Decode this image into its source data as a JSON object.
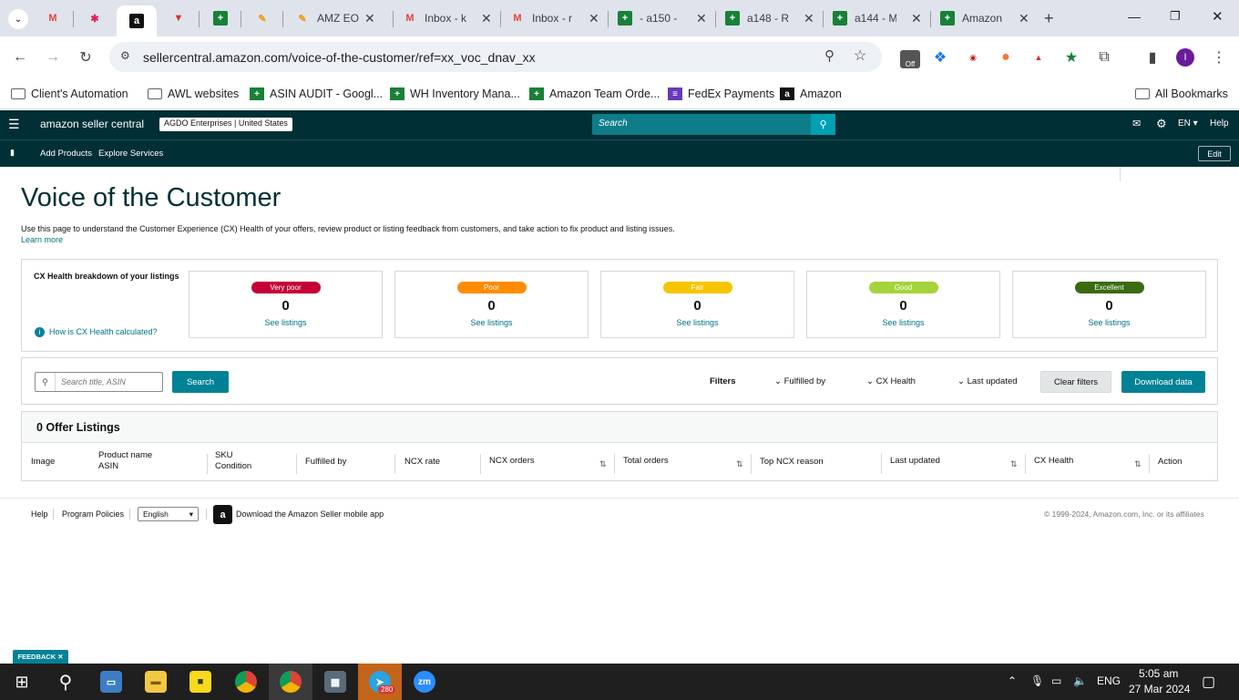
{
  "browser": {
    "tabs": [
      {
        "title": "",
        "icon": "gmail-icon"
      },
      {
        "title": "",
        "icon": "slack-icon"
      },
      {
        "title": "",
        "icon": "amazon-icon",
        "active": true
      },
      {
        "title": "",
        "icon": "red-v-icon"
      },
      {
        "title": "",
        "icon": "sheets-icon"
      },
      {
        "title": "",
        "icon": "pen-icon"
      },
      {
        "title": "AMZ EOD",
        "icon": "pen-icon"
      },
      {
        "title": "Inbox - k",
        "icon": "gmail-icon"
      },
      {
        "title": "Inbox - r",
        "icon": "gmail-icon"
      },
      {
        "title": "- a150 -",
        "icon": "sheets-icon"
      },
      {
        "title": "a148 - R",
        "icon": "sheets-icon"
      },
      {
        "title": "a144 - M",
        "icon": "sheets-icon"
      },
      {
        "title": "Amazon",
        "icon": "sheets-icon"
      }
    ],
    "url": "sellercentral.amazon.com/voice-of-the-customer/ref=xx_voc_dnav_xx",
    "profile_initial": "I",
    "ext_badge_off": "Off",
    "bookmarks": [
      {
        "label": "Client's Automation",
        "icon": "folder-icon"
      },
      {
        "label": "AWL websites",
        "icon": "folder-icon"
      },
      {
        "label": "ASIN AUDIT - Googl...",
        "icon": "sheets-icon"
      },
      {
        "label": "WH Inventory Mana...",
        "icon": "sheets-icon"
      },
      {
        "label": "Amazon Team Orde...",
        "icon": "sheets-icon"
      },
      {
        "label": "FedEx Payments",
        "icon": "forms-icon"
      },
      {
        "label": "Amazon",
        "icon": "amazon-icon"
      }
    ],
    "all_bookmarks": "All Bookmarks"
  },
  "header": {
    "logo": "amazon seller central",
    "account_name": "AGDO Enterprises",
    "account_region": "United States",
    "search_placeholder": "Search",
    "language": "EN",
    "help": "Help",
    "nav": [
      "Add Products",
      "Explore Services"
    ],
    "edit": "Edit"
  },
  "page": {
    "title": "Voice of the Customer",
    "description": "Use this page to understand the Customer Experience (CX) Health of your offers, review product or listing feedback from customers, and take action to fix product and listing issues.",
    "learn_more": "Learn more",
    "breakdown_title": "CX Health breakdown of your listings",
    "how_calc": "How is CX Health calculated?",
    "cx_levels": [
      {
        "label": "Very poor",
        "count": "0",
        "link": "See listings",
        "color": "#c40036"
      },
      {
        "label": "Poor",
        "count": "0",
        "link": "See listings",
        "color": "#ff8c00"
      },
      {
        "label": "Fair",
        "count": "0",
        "link": "See listings",
        "color": "#f7c500"
      },
      {
        "label": "Good",
        "count": "0",
        "link": "See listings",
        "color": "#a4d43b"
      },
      {
        "label": "Excellent",
        "count": "0",
        "link": "See listings",
        "color": "#3a6b10"
      }
    ],
    "search_placeholder": "Search title, ASIN",
    "search_button": "Search",
    "filters_label": "Filters",
    "filter_fulfilled": "Fulfilled by",
    "filter_cx": "CX Health",
    "filter_updated": "Last updated",
    "clear_filters": "Clear filters",
    "download": "Download data",
    "listings_count": "0 Offer Listings",
    "columns": {
      "image": "Image",
      "product_name": "Product name",
      "asin": "ASIN",
      "sku": "SKU",
      "condition": "Condition",
      "fulfilled": "Fulfilled by",
      "ncx_rate": "NCX rate",
      "ncx_orders": "NCX orders",
      "total_orders": "Total orders",
      "top_reason": "Top NCX reason",
      "last_updated": "Last updated",
      "cx_health": "CX Health",
      "action": "Action"
    }
  },
  "footer": {
    "help": "Help",
    "policies": "Program Policies",
    "language": "English",
    "app": "Download the Amazon Seller mobile app",
    "copyright": "© 1999-2024, Amazon.com, Inc. or its affiliates",
    "feedback": "FEEDBACK"
  },
  "taskbar": {
    "time": "5:05 am",
    "date": "27 Mar 2024",
    "lang": "ENG",
    "telegram_badge": "280"
  }
}
